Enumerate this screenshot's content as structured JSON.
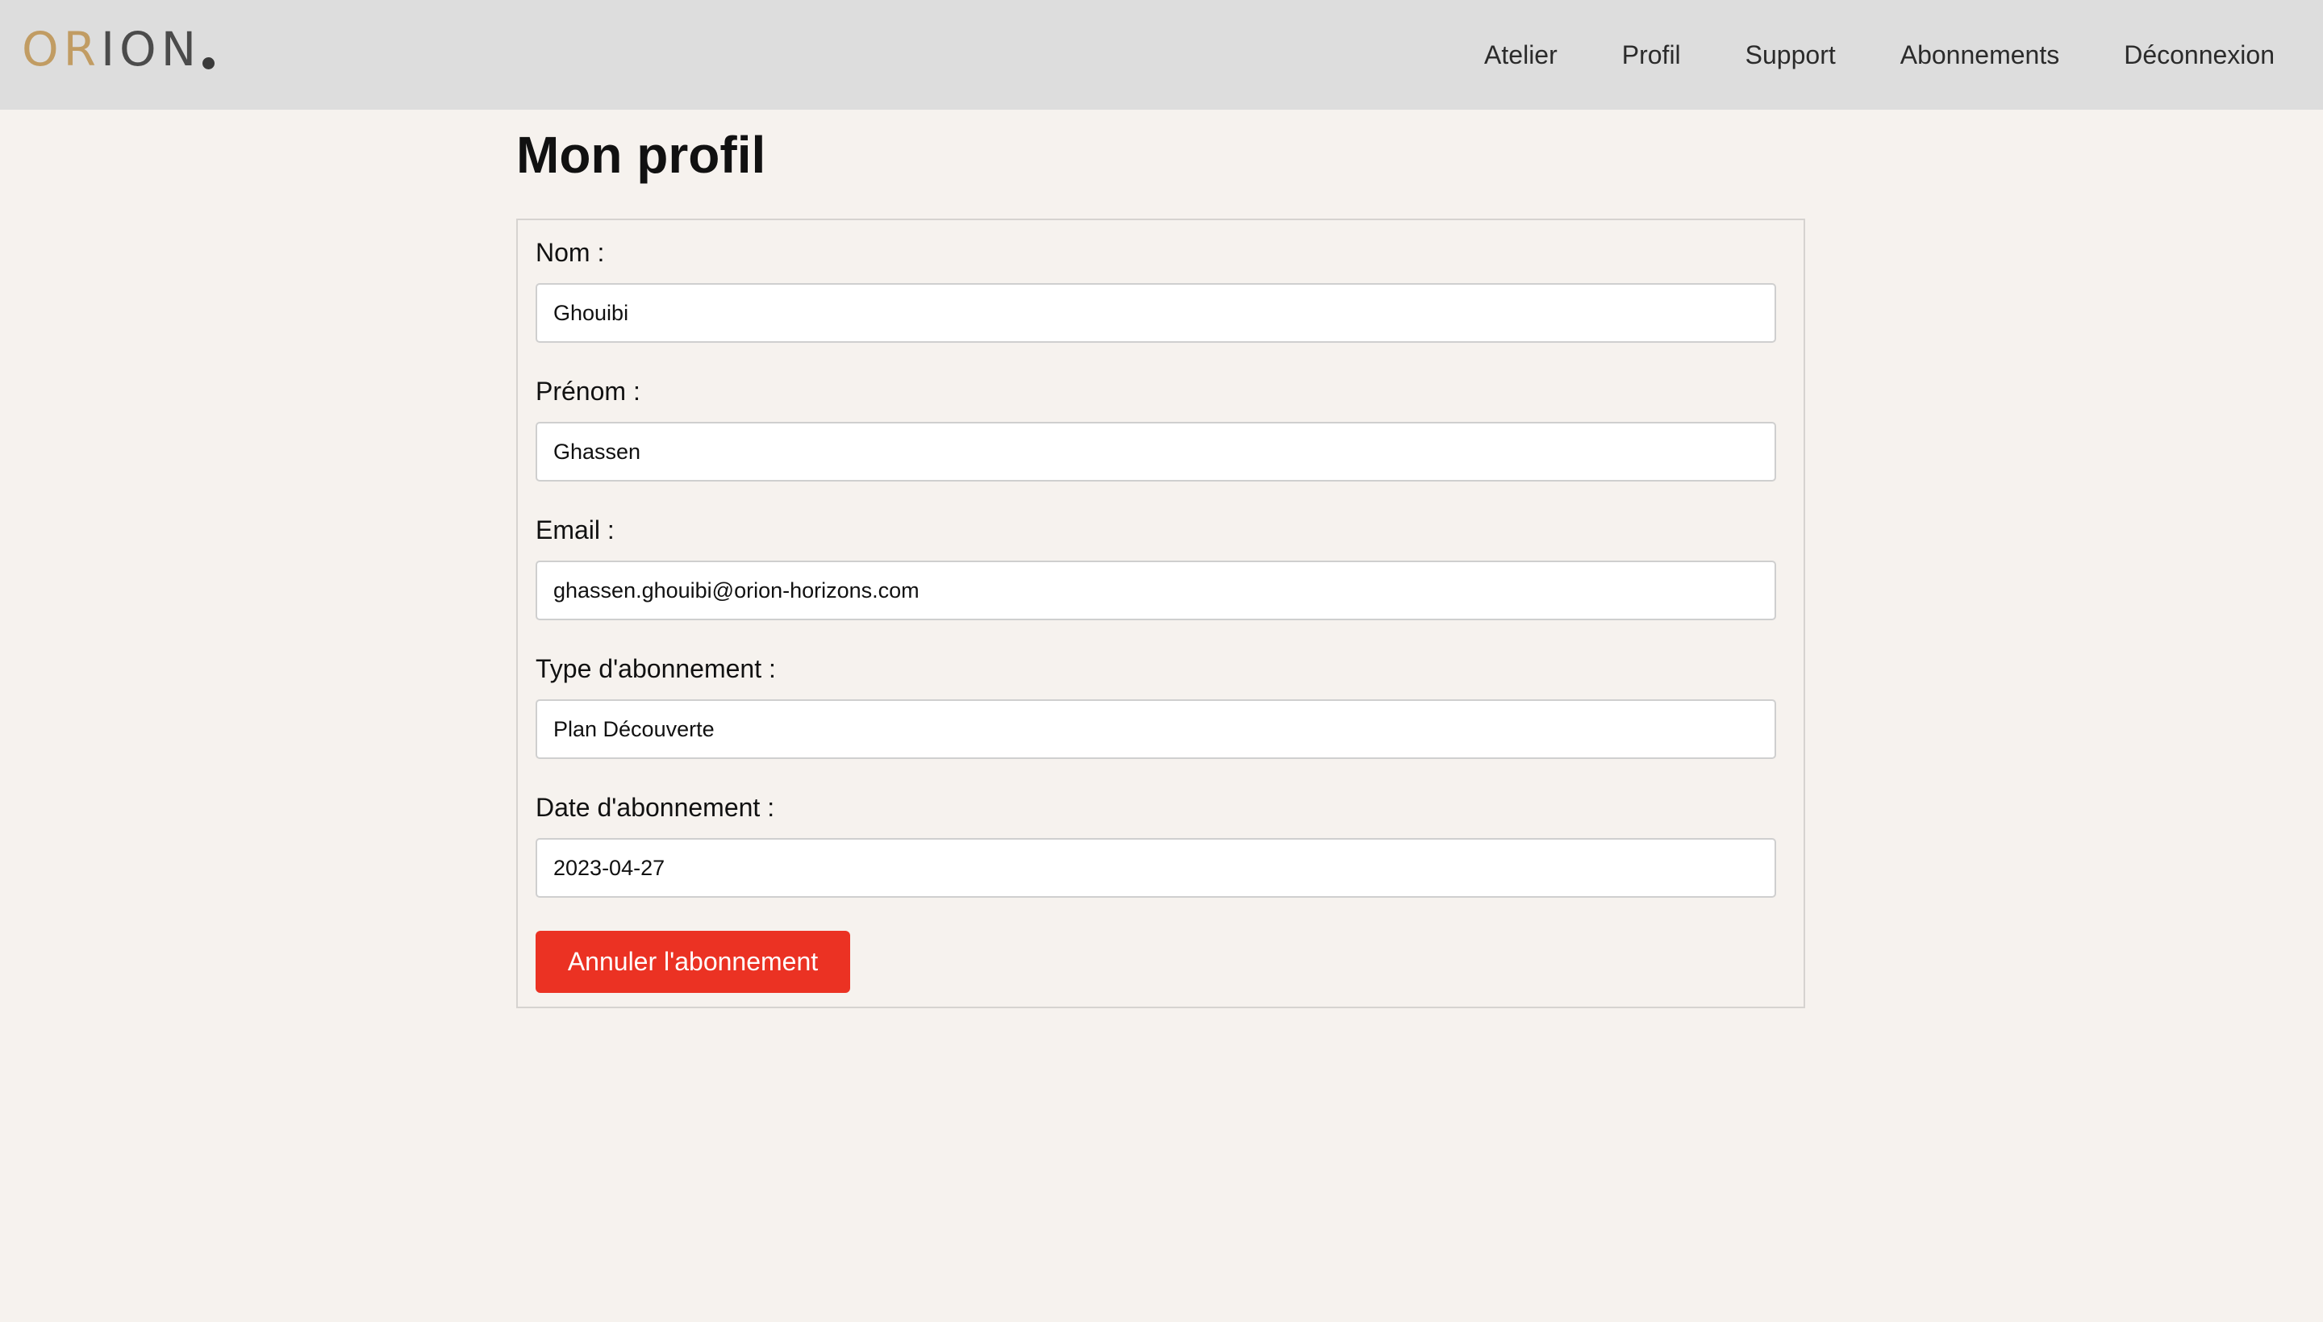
{
  "header": {
    "logo": {
      "part1": "OR",
      "part2": "ION"
    },
    "nav": [
      {
        "label": "Atelier"
      },
      {
        "label": "Profil"
      },
      {
        "label": "Support"
      },
      {
        "label": "Abonnements"
      },
      {
        "label": "Déconnexion"
      }
    ]
  },
  "main": {
    "title": "Mon profil",
    "fields": {
      "nom": {
        "label": "Nom :",
        "value": "Ghouibi"
      },
      "prenom": {
        "label": "Prénom :",
        "value": "Ghassen"
      },
      "email": {
        "label": "Email :",
        "value": "ghassen.ghouibi@orion-horizons.com"
      },
      "type": {
        "label": "Type d'abonnement :",
        "value": "Plan Découverte"
      },
      "date": {
        "label": "Date d'abonnement :",
        "value": "2023-04-27"
      }
    },
    "cancel_label": "Annuler l'abonnement"
  },
  "colors": {
    "header_bg": "#dddddd",
    "page_bg": "#f6f2ee",
    "logo_gold": "#c19c63",
    "logo_dark": "#4b4b4b",
    "danger": "#eb3223"
  }
}
